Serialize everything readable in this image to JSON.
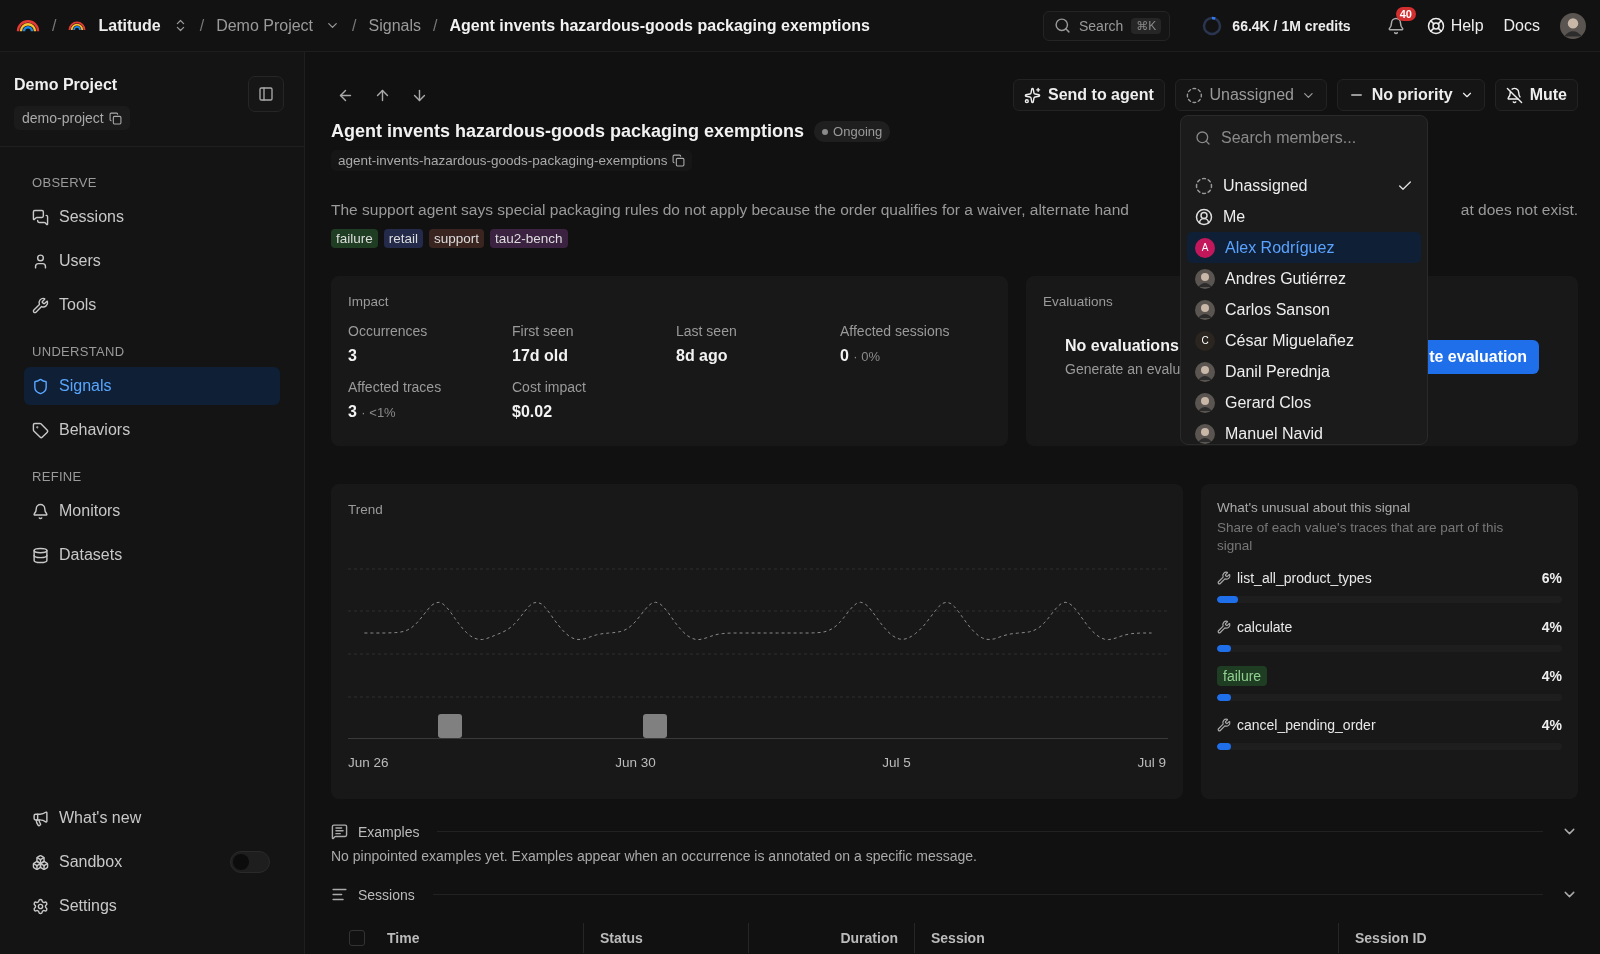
{
  "topbar": {
    "crumbs": [
      {
        "kind": "org",
        "sep": "/",
        "label": "Latitude"
      },
      {
        "kind": "project",
        "sep": "/",
        "label": "Demo Project"
      },
      {
        "kind": "plain",
        "sep": "/",
        "label": "Signals"
      },
      {
        "kind": "current",
        "sep": "/",
        "label": "Agent invents hazardous-goods packaging exemptions"
      }
    ],
    "search": {
      "placeholder": "Search",
      "shortcut": "⌘K"
    },
    "credits": {
      "label": "66.4K / 1M credits",
      "level": 0.066
    },
    "notifications": {
      "count": "40"
    },
    "help": "Help",
    "docs": "Docs"
  },
  "sidebar": {
    "project": "Demo Project",
    "slug": "demo-project",
    "sections": [
      {
        "title": "OBSERVE",
        "items": [
          {
            "label": "Sessions",
            "selected": false
          },
          {
            "label": "Users",
            "selected": false
          },
          {
            "label": "Tools",
            "selected": false
          }
        ]
      },
      {
        "title": "UNDERSTAND",
        "items": [
          {
            "label": "Signals",
            "selected": true
          },
          {
            "label": "Behaviors",
            "selected": false
          }
        ]
      },
      {
        "title": "REFINE",
        "items": [
          {
            "label": "Monitors",
            "selected": false
          },
          {
            "label": "Datasets",
            "selected": false
          }
        ]
      }
    ],
    "footer": [
      {
        "kind": "link",
        "label": "What's new"
      },
      {
        "kind": "toggle",
        "label": "Sandbox",
        "on": false
      },
      {
        "kind": "link",
        "label": "Settings"
      }
    ]
  },
  "actions": {
    "send": "Send to agent",
    "assignee": "Unassigned",
    "priority": "No priority",
    "mute": "Mute"
  },
  "assign_menu": {
    "placeholder": "Search members...",
    "members": [
      {
        "kind": "none",
        "name": "Unassigned",
        "selected": true,
        "hovered": false
      },
      {
        "kind": "me",
        "name": "Me",
        "selected": false,
        "hovered": false
      },
      {
        "kind": "initial",
        "name": "Alex Rodríguez",
        "initial": "A",
        "color": "#c2185b",
        "selected": false,
        "hovered": true
      },
      {
        "kind": "photo",
        "name": "Andres Gutiérrez",
        "selected": false,
        "hovered": false
      },
      {
        "kind": "photo",
        "name": "Carlos Sanson",
        "selected": false,
        "hovered": false
      },
      {
        "kind": "initial",
        "name": "César Miguelañez",
        "initial": "C",
        "color": "#2b2520",
        "selected": false,
        "hovered": false
      },
      {
        "kind": "photo",
        "name": "Danil Perednja",
        "selected": false,
        "hovered": false
      },
      {
        "kind": "photo",
        "name": "Gerard Clos",
        "selected": false,
        "hovered": false
      },
      {
        "kind": "photo",
        "name": "Manuel Navid",
        "selected": false,
        "hovered": false
      }
    ]
  },
  "issue": {
    "title": "Agent invents hazardous-goods packaging exemptions",
    "status": "Ongoing",
    "slug": "agent-invents-hazardous-goods-packaging-exemptions",
    "description_start": "The support agent says special packaging rules do not apply because the order qualifies for a waiver, alternate hand",
    "description_end": "at does not exist.",
    "tags": [
      {
        "label": "failure",
        "color": "#1f3d22"
      },
      {
        "label": "retail",
        "color": "#232a4a"
      },
      {
        "label": "support",
        "color": "#3a2420"
      },
      {
        "label": "tau2-bench",
        "color": "#3a2240"
      }
    ]
  },
  "impact": {
    "title": "Impact",
    "stats": [
      {
        "label": "Occurrences",
        "value": "3"
      },
      {
        "label": "First seen",
        "value": "17d old"
      },
      {
        "label": "Last seen",
        "value": "8d ago"
      },
      {
        "label": "Affected sessions",
        "value": "0",
        "sub": "· 0%"
      },
      {
        "label": "Affected traces",
        "value": "3",
        "sub": "· <1%"
      },
      {
        "label": "Cost impact",
        "value": "$0.02"
      }
    ]
  },
  "evaluations": {
    "title": "Evaluations",
    "empty_title": "No evaluations",
    "empty_text": "Generate an evalu",
    "button": "te evaluation"
  },
  "trend": {
    "title": "Trend",
    "x_labels": [
      "Jun 26",
      "Jun 30",
      "Jul 5",
      "Jul 9"
    ]
  },
  "unusual": {
    "title": "What's unusual about this signal",
    "subtitle": "Share of each value's traces that are part of this signal",
    "items": [
      {
        "kind": "tool",
        "label": "list_all_product_types",
        "value": "6%",
        "level": 0.06
      },
      {
        "kind": "tool",
        "label": "calculate",
        "value": "4%",
        "level": 0.04
      },
      {
        "kind": "tag",
        "label": "failure",
        "value": "4%",
        "level": 0.04
      },
      {
        "kind": "tool",
        "label": "cancel_pending_order",
        "value": "4%",
        "level": 0.04
      }
    ]
  },
  "examples": {
    "title": "Examples",
    "text": "No pinpointed examples yet. Examples appear when an occurrence is annotated on a specific message."
  },
  "sessions": {
    "title": "Sessions",
    "select_all": false,
    "columns": [
      "Time",
      "Status",
      "Duration",
      "Session",
      "Session ID"
    ]
  }
}
